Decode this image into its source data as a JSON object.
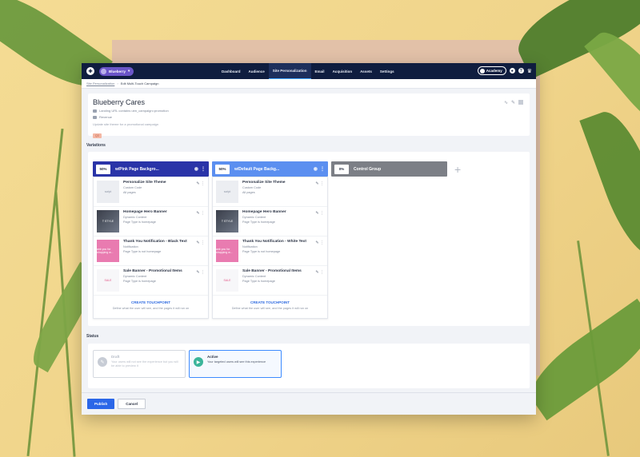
{
  "topnav": {
    "site_name": "Blueberry",
    "items": [
      "Dashboard",
      "Audience",
      "Site Personalization",
      "Email",
      "Acquisition",
      "Assets",
      "Settings"
    ],
    "active_index": 2,
    "academy_label": "Academy"
  },
  "breadcrumb": {
    "parent": "Site Personalization",
    "current": "Edit Multi-Touch Campaign"
  },
  "campaign": {
    "title": "Blueberry Cares",
    "targeting": "Landing URL contains utm_campaign=promotion",
    "goal": "Revenue",
    "description": "Update site theme for a promotional campaign",
    "tag": "Q3"
  },
  "variations": {
    "section_label": "Variations",
    "columns": [
      {
        "percent": "50%",
        "name": "w/Pink Page Backgro...",
        "color": "#2a34a8",
        "touchpoints": [
          {
            "title": "Personalize Site Theme",
            "type": "Custom Code",
            "scope": "All pages",
            "thumb": "script",
            "thumb_text": "script"
          },
          {
            "title": "Homepage Hero Banner",
            "type": "Dynamic Content",
            "scope": "Page Type is homepage",
            "thumb": "banner",
            "thumb_text": "T STYLE"
          },
          {
            "title": "Thank You Notification - Black Text",
            "type": "Notification",
            "scope": "Page Type is not homepage",
            "thumb": "notif",
            "thumb_text": "ank you for shopping w..."
          },
          {
            "title": "Sale Banner - Promotional Items",
            "type": "Dynamic Content",
            "scope": "Page Type is homepage",
            "thumb": "sale",
            "thumb_text": "SALE"
          }
        ],
        "create_label": "CREATE TOUCHPOINT",
        "create_hint": "Define what the user will see, and the pages it will run on"
      },
      {
        "percent": "50%",
        "name": "w/Default Page Backg...",
        "color": "#5b8ff0",
        "touchpoints": [
          {
            "title": "Personalize Site Theme",
            "type": "Custom Code",
            "scope": "All pages",
            "thumb": "script",
            "thumb_text": "script"
          },
          {
            "title": "Homepage Hero Banner",
            "type": "Dynamic Content",
            "scope": "Page Type is homepage",
            "thumb": "banner",
            "thumb_text": "T STYLE"
          },
          {
            "title": "Thank You Notification - White Text",
            "type": "Notification",
            "scope": "Page Type is not homepage",
            "thumb": "notif",
            "thumb_text": "ank you for shopping w..."
          },
          {
            "title": "Sale Banner - Promotional Items",
            "type": "Dynamic Content",
            "scope": "Page Type is homepage",
            "thumb": "sale",
            "thumb_text": "SALE"
          }
        ],
        "create_label": "CREATE TOUCHPOINT",
        "create_hint": "Define what the user will see, and the pages it will run on"
      },
      {
        "percent": "0%",
        "name": "Control Group",
        "color": "#7c7f86"
      }
    ]
  },
  "status": {
    "section_label": "Status",
    "options": [
      {
        "title": "Draft",
        "description": "Your users will not see the experience but you will be able to preview it",
        "selected": false
      },
      {
        "title": "Active",
        "description": "Your targeted users will see this experience",
        "selected": true
      }
    ]
  },
  "footer": {
    "publish_label": "Publish",
    "cancel_label": "Cancel"
  }
}
